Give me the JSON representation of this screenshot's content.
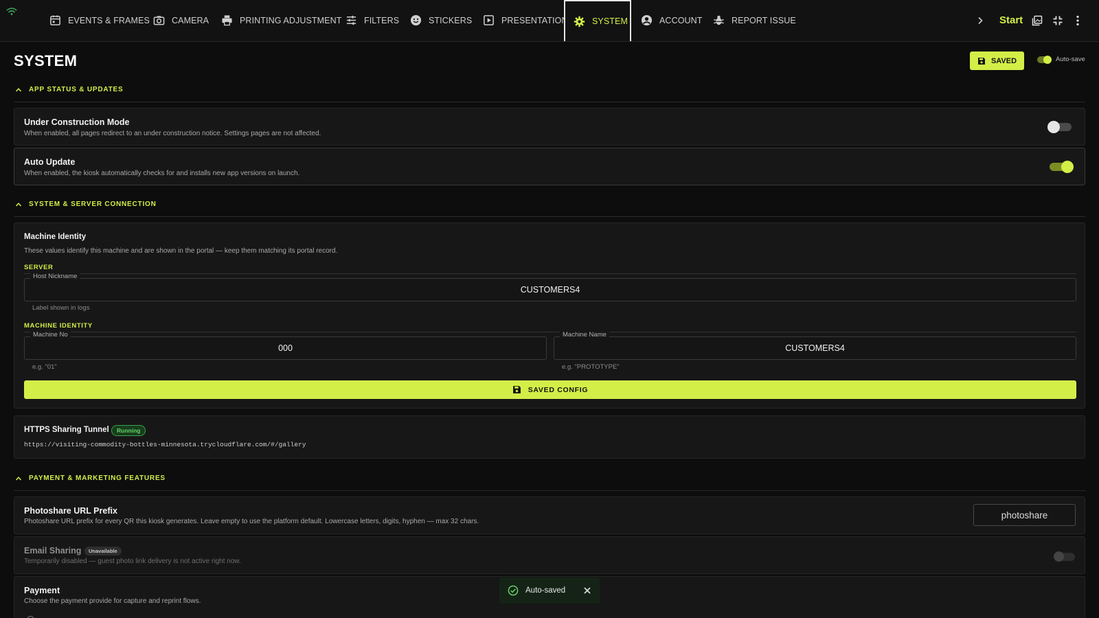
{
  "nav": {
    "items": [
      {
        "label": "EVENTS & FRAMES",
        "icon": "calendar-icon"
      },
      {
        "label": "CAMERA",
        "icon": "camera-icon"
      },
      {
        "label": "PRINTING ADJUSTMENT",
        "icon": "printer-icon"
      },
      {
        "label": "FILTERS",
        "icon": "sliders-icon"
      },
      {
        "label": "STICKERS",
        "icon": "smiley-icon"
      },
      {
        "label": "PRESENTATION",
        "icon": "play-icon"
      },
      {
        "label": "SYSTEM",
        "icon": "gear-icon"
      },
      {
        "label": "ACCOUNT",
        "icon": "user-icon"
      },
      {
        "label": "REPORT ISSUE",
        "icon": "bug-icon"
      }
    ],
    "active": "SYSTEM",
    "start_label": "Start"
  },
  "header": {
    "title": "SYSTEM",
    "saved_label": "SAVED",
    "autosave_label": "Auto-save",
    "autosave_on": true
  },
  "sections": {
    "app_status": {
      "title": "APP STATUS & UPDATES",
      "under_construction": {
        "title": "Under Construction Mode",
        "desc": "When enabled, all pages redirect to an under construction notice. Settings pages are not affected.",
        "enabled": false
      },
      "auto_update": {
        "title": "Auto Update",
        "desc": "When enabled, the kiosk automatically checks for and installs new app versions on launch.",
        "enabled": true
      }
    },
    "server": {
      "title": "SYSTEM & SERVER CONNECTION",
      "machine_identity_card": {
        "title": "Machine Identity",
        "desc": "These values identify this machine and are shown in the portal — keep them matching its portal record.",
        "server_subhead": "SERVER",
        "host_nickname": {
          "label": "Host Nickname",
          "value": "CUSTOMERS4",
          "helper": "Label shown in logs"
        },
        "machine_subhead": "MACHINE IDENTITY",
        "machine_no": {
          "label": "Machine No",
          "value": "000",
          "helper": "e.g. \"01\""
        },
        "machine_name": {
          "label": "Machine Name",
          "value": "CUSTOMERS4",
          "helper": "e.g. \"PROTOTYPE\""
        },
        "save_button": "SAVED CONFIG"
      },
      "tunnel": {
        "title": "HTTPS Sharing Tunnel",
        "status": "Running",
        "url": "https://visiting-commodity-bottles-minnesota.trycloudflare.com/#/gallery"
      }
    },
    "payment": {
      "title": "PAYMENT & MARKETING FEATURES",
      "photoshare": {
        "title": "Photoshare URL Prefix",
        "desc": "Photoshare URL prefix for every QR this kiosk generates. Leave empty to use the platform default. Lowercase letters, digits, hyphen — max 32 chars.",
        "value": "photoshare"
      },
      "email": {
        "title": "Email Sharing",
        "badge": "Unavailable",
        "desc": "Temporarily disabled — guest photo link delivery is not active right now.",
        "enabled": false
      },
      "payment_card": {
        "title": "Payment",
        "desc": "Choose the payment provide for capture and reprint flows."
      }
    }
  },
  "toast": {
    "text": "Auto-saved"
  },
  "colors": {
    "accent": "#d4ee48",
    "background": "#0d0d0d",
    "card": "#171717",
    "success": "#65d06b"
  }
}
